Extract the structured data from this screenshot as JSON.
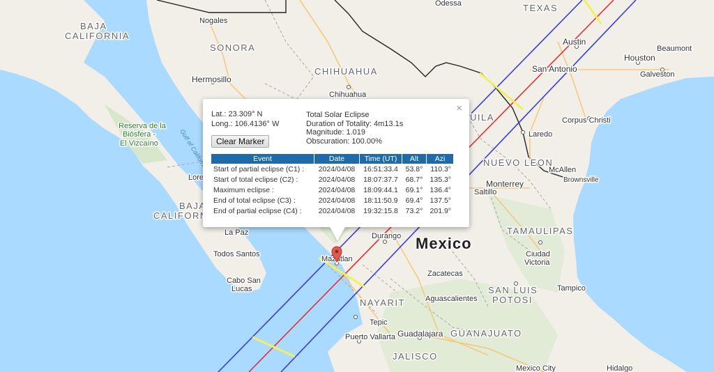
{
  "map": {
    "places": {
      "odessa": "Odessa",
      "texas": "TEXAS",
      "austin": "Austin",
      "houston": "Houston",
      "beaumont": "Beaumont",
      "san_antonio": "San Antonio",
      "galveston": "Galveston",
      "corpus_christi": "Corpus Christi",
      "laredo": "Laredo",
      "mcallen": "McAllen",
      "brownsville": "Brownsville",
      "nuevo_leon": "NUEVO LEON",
      "monterrey": "Monterrey",
      "saltillo": "Saltillo",
      "tamaulipas": "TAMAULIPAS",
      "ciudad_victoria_1": "Ciudad",
      "ciudad_victoria_2": "Victoria",
      "tampico": "Tampico",
      "san_luis_potosi_1": "SAN LUIS",
      "san_luis_potosi_2": "POTOSI",
      "mexico": "Mexico",
      "zacatecas": "Zacatecas",
      "aguascalientes": "Aguascalientes",
      "guanajuato": "GUANAJUATO",
      "guadalajara": "Guadalajara",
      "jalisco": "JALISCO",
      "mexico_city": "Mexico City",
      "hidalgo": "Hidalgo",
      "nayarit": "NAYARIT",
      "tepic": "Tepic",
      "puerto_vallarta": "Puerto Vallarta",
      "durango": "Durango",
      "mazatlan": "Mazatlan",
      "baja_california_1": "BAJA",
      "baja_california_2": "CALIFORNIA",
      "baja_california_sur_1": "BAJA",
      "baja_california_sur_2": "CALIFORNIA",
      "la_paz": "La Paz",
      "todos_santos": "Todos Santos",
      "cabo_san_lucas_1": "Cabo San",
      "cabo_san_lucas_2": "Lucas",
      "loreto": "Loreto",
      "nogales": "Nogales",
      "sonora": "SONORA",
      "hermosillo": "Hermosillo",
      "chihuahua_state": "CHIHUAHUA",
      "chihuahua_city": "Chihuahua",
      "coahuila_partial": "UILA",
      "reserva_1": "Reserva de la",
      "reserva_2": "Biósfera -",
      "reserva_3": "El Vizcaíno",
      "gulf_of_california": "Gulf of California"
    }
  },
  "popup": {
    "lat": "Lat.: 23.309° N",
    "long": "Long.: 106.4136° W",
    "eclipse_type": "Total Solar Eclipse",
    "duration": "Duration of Totality: 4m13.1s",
    "magnitude": "Magnitude: 1.019",
    "obscuration": "Obscuration: 100.00%",
    "clear_button": "Clear Marker",
    "close_symbol": "×",
    "table": {
      "headers": [
        "Event",
        "Date",
        "Time (UT)",
        "Alt",
        "Azi"
      ],
      "rows": [
        [
          "Start of partial eclipse (C1) :",
          "2024/04/08",
          "16:51:33.4",
          "53.8°",
          "110.3°"
        ],
        [
          "Start of total eclipse (C2) :",
          "2024/04/08",
          "18:07:37.7",
          "68.7°",
          "135.3°"
        ],
        [
          "Maximum eclipse :",
          "2024/04/08",
          "18:09:44.1",
          "69.1°",
          "136.4°"
        ],
        [
          "End of total eclipse (C3) :",
          "2024/04/08",
          "18:11:50.9",
          "69.4°",
          "137.5°"
        ],
        [
          "End of partial eclipse (C4) :",
          "2024/04/08",
          "19:32:15.8",
          "73.2°",
          "201.9°"
        ]
      ]
    }
  },
  "colors": {
    "water": "#aadaff",
    "land": "#f2efe9",
    "path_limit": "#3c3cd8",
    "centerline": "#e03030",
    "max_duration": "#f0f060",
    "table_header": "#1f6aa8",
    "marker": "#e05a4e"
  }
}
